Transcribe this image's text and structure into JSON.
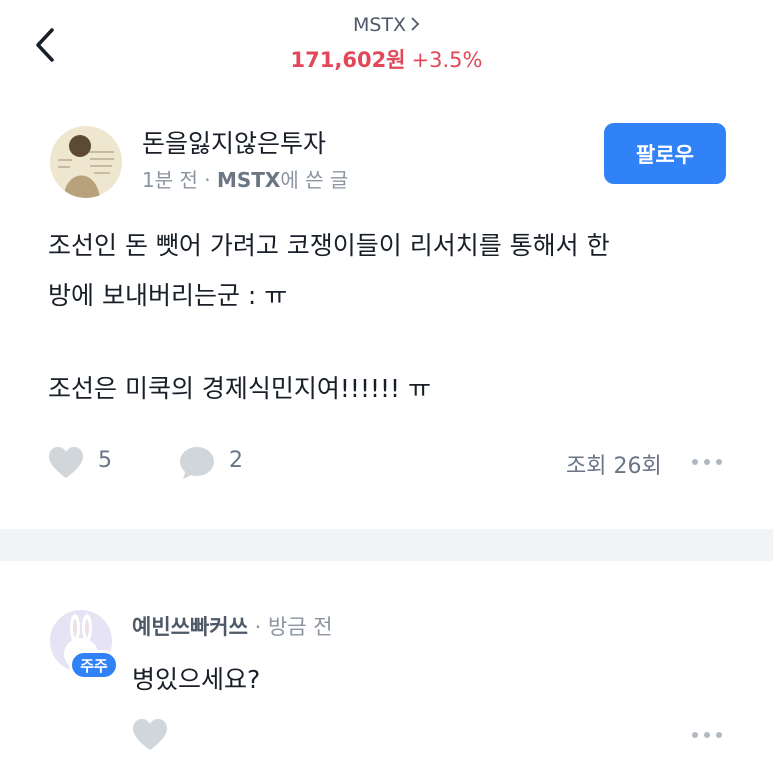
{
  "header": {
    "ticker": "MSTX",
    "price": "171,602원",
    "change": "+3.5%",
    "price_color": "#e1495a"
  },
  "post": {
    "author": "돈을잃지않은투자",
    "time": "1분 전",
    "separator": "·",
    "board": "MSTX",
    "board_suffix": "에 쓴 글",
    "follow_label": "팔로우",
    "body_lines": [
      "조선인 돈 뺏어 가려고 코쟁이들이 리서치를 통해서 한",
      "방에 보내버리는군 : ㅠ",
      "조선은 미쿡의 경제식민지여!!!!!!  ㅠ"
    ],
    "likes": "5",
    "comments": "2",
    "views": "조회 26회"
  },
  "comment": {
    "author": "예빈쓰빠커쓰",
    "separator": "·",
    "time": "방금 전",
    "badge": "주주",
    "text": "병있으세요?"
  },
  "colors": {
    "accent": "#3182f6",
    "icon_gray": "#d1d6db",
    "divider": "#f2f4f6"
  },
  "icons": [
    "back-arrow-icon",
    "chevron-right-icon",
    "heart-icon",
    "comment-bubble-icon",
    "more-dots-icon"
  ]
}
